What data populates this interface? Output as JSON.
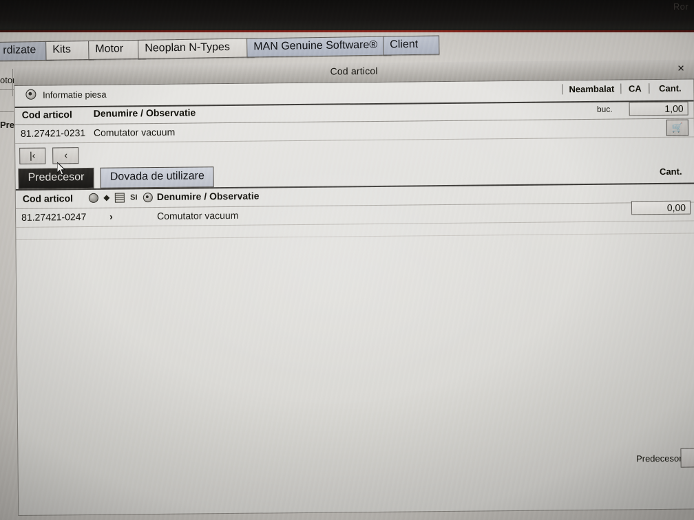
{
  "bezel": {
    "ghost_text": "Ror"
  },
  "tabstrip": {
    "tabs": [
      {
        "label": "rdizate",
        "state": "dim"
      },
      {
        "label": "Kits",
        "state": "normal"
      },
      {
        "label": "Motor",
        "state": "normal"
      },
      {
        "label": "Neoplan N-Types",
        "state": "normal"
      },
      {
        "label": "MAN Genuine Software®",
        "state": "accent"
      },
      {
        "label": "Client",
        "state": "accent"
      }
    ]
  },
  "background_window": {
    "fragment_motor": "otor",
    "fragment_pre": "Pre"
  },
  "dialog": {
    "title": "Cod articol",
    "close_label": "×",
    "panel_header": {
      "icon": "info-circle-icon",
      "label": "Informatie piesa",
      "columns": [
        "Neambalat",
        "CA",
        "Cant."
      ]
    },
    "grid1": {
      "headers": {
        "cod": "Cod articol",
        "denumire": "Denumire / Observatie",
        "unit": "buc.",
        "qty": "1,00"
      },
      "rows": [
        {
          "cod": "81.27421-0231",
          "denumire": "Comutator vacuum",
          "cart_icon": "shopping-cart-icon"
        }
      ]
    },
    "nav_buttons": [
      {
        "label": "|‹",
        "name": "first"
      },
      {
        "label": "‹",
        "name": "previous"
      }
    ],
    "tabs": [
      {
        "label": "Predecesor",
        "active": true
      },
      {
        "label": "Dovada de utilizare",
        "active": false
      }
    ],
    "grid2": {
      "cant_label": "Cant.",
      "cant_value": "0,00",
      "headers": {
        "cod": "Cod articol",
        "denumire": "Denumire / Observatie",
        "icons": [
          "globe-icon",
          "code-icon",
          "list-icon",
          "SI",
          "info-circle-icon"
        ]
      },
      "rows": [
        {
          "cod": "81.27421-0247",
          "arrow": "›",
          "denumire": "Comutator vacuum"
        }
      ]
    },
    "footer": {
      "predecesor_label": "Predecesor"
    }
  }
}
